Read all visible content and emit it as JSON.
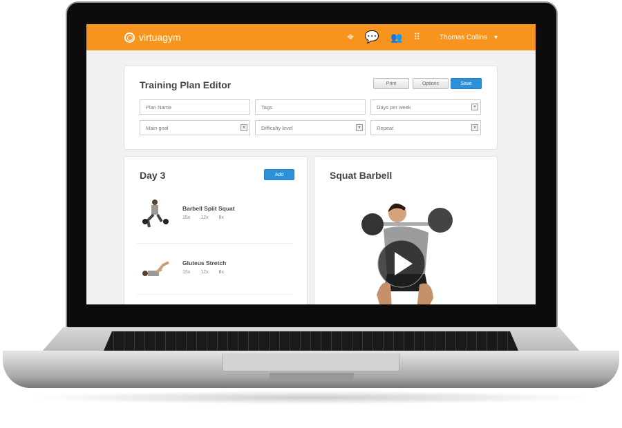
{
  "app": {
    "brand": "virtuagym",
    "user_name": "Thomas Collins",
    "brand_color": "#f7941d",
    "accent_color": "#2e91d8"
  },
  "nav_icons": [
    "crosshair-icon",
    "chat-icon",
    "users-icon",
    "grid-icon"
  ],
  "editor": {
    "title": "Training Plan Editor",
    "print_label": "Print",
    "options_label": "Options",
    "save_label": "Save",
    "fields": {
      "plan_name": "Plan Name",
      "tags": "Tags",
      "days_per_week": "Days per week",
      "main_goal": "Main goal",
      "difficulty": "Difficulty level",
      "repeat": "Repeat"
    }
  },
  "day": {
    "title": "Day 3",
    "add_label": "Add",
    "exercises": [
      {
        "name": "Barbell Split Squat",
        "reps": [
          "15x",
          "12x",
          "8x"
        ]
      },
      {
        "name": "Gluteus Stretch",
        "reps": [
          "15x",
          "12x",
          "8x"
        ]
      }
    ]
  },
  "preview": {
    "title": "Squat Barbell"
  }
}
